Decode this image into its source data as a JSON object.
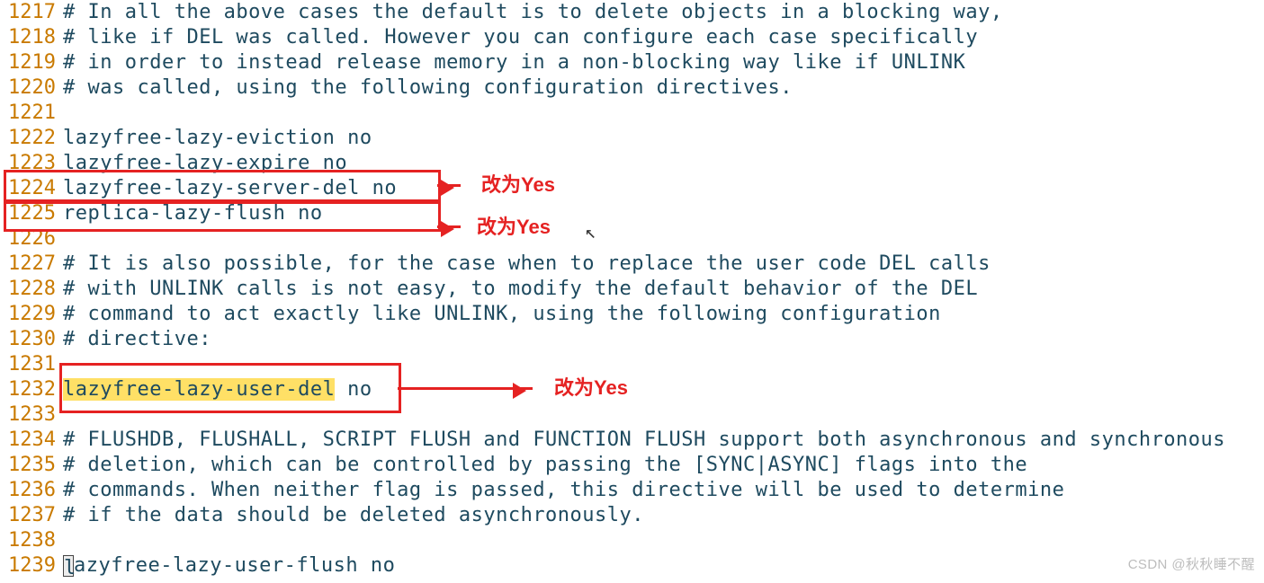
{
  "lines": [
    {
      "num": "1217",
      "text": "# In all the above cases the default is to delete objects in a blocking way,"
    },
    {
      "num": "1218",
      "text": "# like if DEL was called. However you can configure each case specifically"
    },
    {
      "num": "1219",
      "text": "# in order to instead release memory in a non-blocking way like if UNLINK"
    },
    {
      "num": "1220",
      "text": "# was called, using the following configuration directives."
    },
    {
      "num": "1221",
      "text": ""
    },
    {
      "num": "1222",
      "text": "lazyfree-lazy-eviction no"
    },
    {
      "num": "1223",
      "text": "lazyfree-lazy-expire no"
    },
    {
      "num": "1224",
      "text": "lazyfree-lazy-server-del no"
    },
    {
      "num": "1225",
      "text": "replica-lazy-flush no"
    },
    {
      "num": "1226",
      "text": ""
    },
    {
      "num": "1227",
      "text": "# It is also possible, for the case when to replace the user code DEL calls"
    },
    {
      "num": "1228",
      "text": "# with UNLINK calls is not easy, to modify the default behavior of the DEL"
    },
    {
      "num": "1229",
      "text": "# command to act exactly like UNLINK, using the following configuration"
    },
    {
      "num": "1230",
      "text": "# directive:"
    },
    {
      "num": "1231",
      "text": ""
    },
    {
      "num": "1232",
      "text_hl": "lazyfree-lazy-user-del",
      "text_after": " no"
    },
    {
      "num": "1233",
      "text": ""
    },
    {
      "num": "1234",
      "text": "# FLUSHDB, FLUSHALL, SCRIPT FLUSH and FUNCTION FLUSH support both asynchronous and synchronous"
    },
    {
      "num": "1235",
      "text": "# deletion, which can be controlled by passing the [SYNC|ASYNC] flags into the"
    },
    {
      "num": "1236",
      "text": "# commands. When neither flag is passed, this directive will be used to determine"
    },
    {
      "num": "1237",
      "text": "# if the data should be deleted asynchronously."
    },
    {
      "num": "1238",
      "text": ""
    },
    {
      "num": "1239",
      "text_after": "azyfree-lazy-user-flush no",
      "cursor_prefix": "l"
    }
  ],
  "annotations": {
    "label1": "改为Yes",
    "label2": "改为Yes",
    "label3": "改为Yes"
  },
  "watermark": "CSDN @秋秋睡不醒"
}
